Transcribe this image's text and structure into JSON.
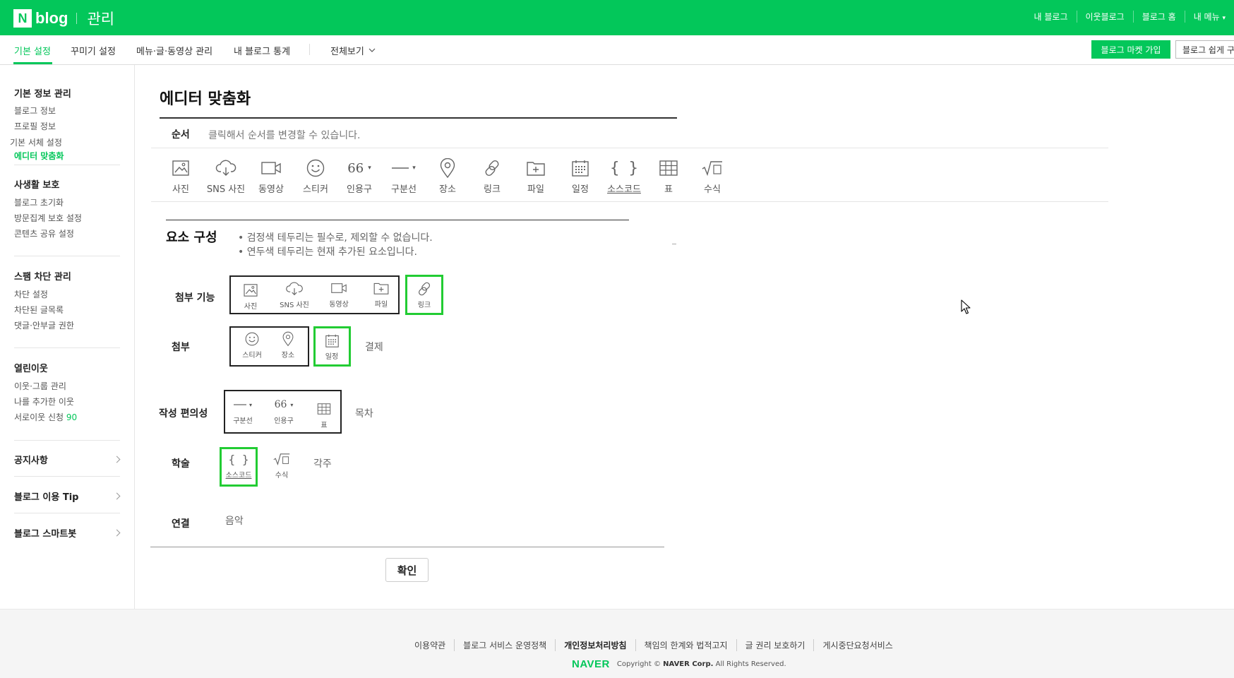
{
  "header": {
    "logo_n": "N",
    "logo_blog": "blog",
    "admin_label": "관리",
    "links": [
      "내 블로그",
      "이웃블로그",
      "블로그 홈",
      "내 메뉴"
    ],
    "brand_color": "#03c75a"
  },
  "tabs": {
    "basic": "기본 설정",
    "decorate": "꾸미기 설정",
    "menu": "메뉴·글·동영상 관리",
    "stats": "내 블로그 통계",
    "all": "전체보기",
    "market_button": "블로그 마켓 가입",
    "easy_button": "블로그 쉽게 구"
  },
  "sidebar": {
    "basic_info": {
      "title": "기본 정보 관리",
      "items": [
        "블로그 정보",
        "프로필 정보",
        "기본 서체 설정",
        "에디터 맞춤화"
      ]
    },
    "privacy": {
      "title": "사생활 보호",
      "items": [
        "블로그 초기화",
        "방문집계 보호 설정",
        "콘텐츠 공유 설정"
      ]
    },
    "spam": {
      "title": "스팸 차단 관리",
      "items": [
        "차단 설정",
        "차단된 글목록",
        "댓글·안부글 권한"
      ]
    },
    "neighbors": {
      "title": "열린이웃",
      "items": [
        "이웃·그룹 관리",
        "나를 추가한 이웃",
        "서로이웃 신청"
      ],
      "request_count": "90"
    },
    "notice": "공지사항",
    "tip": "블로그 이용 Tip",
    "smartbook": "블로그 스마트봇"
  },
  "main": {
    "title": "에디터 맞춤화",
    "order": {
      "label": "순서",
      "description": "클릭해서 순서를 변경할 수 있습니다.",
      "items": [
        "사진",
        "SNS 사진",
        "동영상",
        "스티커",
        "인용구",
        "구분선",
        "장소",
        "링크",
        "파일",
        "일정",
        "소스코드",
        "표",
        "수식"
      ]
    },
    "components": {
      "title": "요소 구성",
      "notes": [
        "검정색 테두리는 필수로, 제외할 수 없습니다.",
        "연두색 테두리는 현재 추가된 요소입니다."
      ],
      "rows": {
        "attach_func": {
          "label": "첨부 기능",
          "required": [
            "사진",
            "SNS 사진",
            "동영상",
            "파일"
          ],
          "added": [
            "링크"
          ]
        },
        "attach": {
          "label": "첨부",
          "required": [
            "스티커",
            "장소"
          ],
          "added": [
            "일정"
          ],
          "available": [
            "결제"
          ]
        },
        "writing": {
          "label": "작성 편의성",
          "required": [
            "구분선",
            "인용구",
            "표"
          ],
          "available": [
            "목차"
          ]
        },
        "academic": {
          "label": "학술",
          "added": [
            "소스코드"
          ],
          "available": [
            "수식",
            "각주"
          ]
        },
        "connect": {
          "label": "연결",
          "available": [
            "음악"
          ]
        }
      }
    },
    "confirm": "확인"
  },
  "footer": {
    "links": [
      "이용약관",
      "블로그 서비스 운영정책",
      "개인정보처리방침",
      "책임의 한계와 법적고지",
      "글 권리 보호하기",
      "게시중단요청서비스"
    ],
    "naver": "NAVER",
    "copyright_prefix": "Copyright ©",
    "copyright_corp": "NAVER Corp.",
    "copyright_suffix": "All Rights Reserved."
  }
}
